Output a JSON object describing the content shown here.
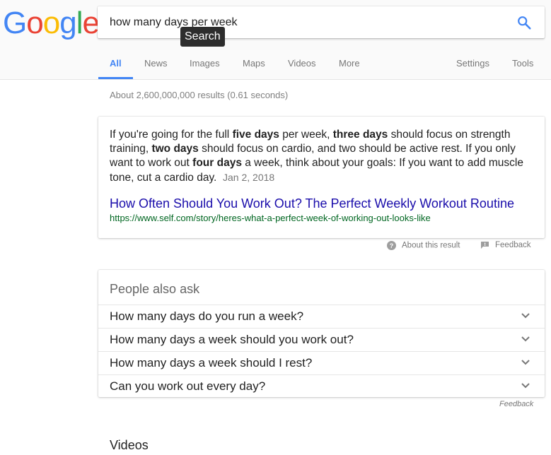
{
  "logo": {
    "letters": [
      "G",
      "o",
      "o",
      "g",
      "l",
      "e"
    ]
  },
  "search": {
    "query": "how many days per week",
    "tooltip": "Search"
  },
  "tabs": {
    "left": [
      "All",
      "News",
      "Images",
      "Maps",
      "Videos",
      "More"
    ],
    "right": [
      "Settings",
      "Tools"
    ],
    "active": "All"
  },
  "stats": "About 2,600,000,000 results (0.61 seconds)",
  "snippet": {
    "text": [
      {
        "t": "If you're going for the full ",
        "b": false
      },
      {
        "t": "five days",
        "b": true
      },
      {
        "t": " per week, ",
        "b": false
      },
      {
        "t": "three days",
        "b": true
      },
      {
        "t": " should focus on strength training, ",
        "b": false
      },
      {
        "t": "two days",
        "b": true
      },
      {
        "t": " should focus on cardio, and two should be active rest. If you only want to work out ",
        "b": false
      },
      {
        "t": "four days",
        "b": true
      },
      {
        "t": " a week, think about your goals: If you want to add muscle tone, cut a cardio day.",
        "b": false
      }
    ],
    "date": "Jan 2, 2018",
    "title": "How Often Should You Work Out? The Perfect Weekly Workout Routine",
    "url": "https://www.self.com/story/heres-what-a-perfect-week-of-working-out-looks-like"
  },
  "under_snippet": {
    "about": "About this result",
    "feedback": "Feedback"
  },
  "people_also_ask": {
    "heading": "People also ask",
    "questions": [
      "How many days do you run a week?",
      "How many days a week should you work out?",
      "How many days a week should I rest?",
      "Can you work out every day?"
    ],
    "feedback": "Feedback"
  },
  "videos_heading": "Videos",
  "colors": {
    "link": "#1a0dab",
    "url": "#006621",
    "accent": "#4285f4"
  }
}
